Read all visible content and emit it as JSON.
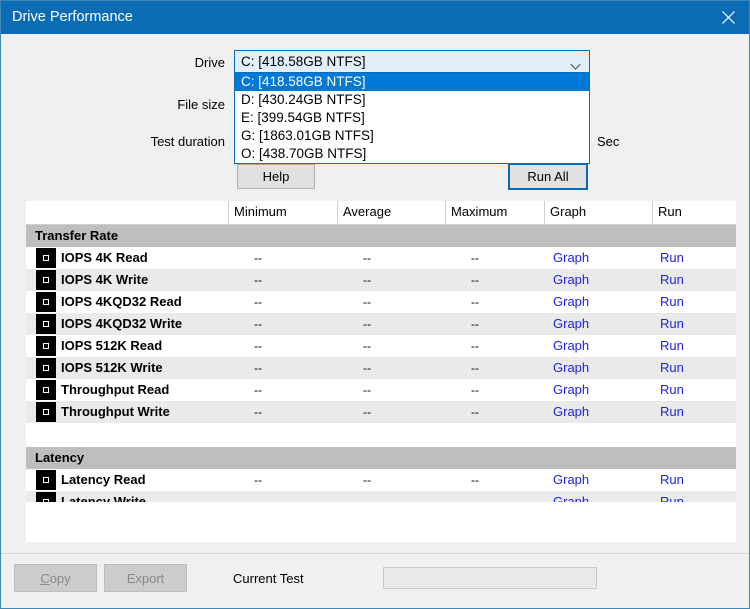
{
  "window": {
    "title": "Drive Performance",
    "close_icon": "close-icon",
    "titlebar_color": "#0a6cb4"
  },
  "form": {
    "drive_label": "Drive",
    "file_size_label": "File size",
    "test_duration_label": "Test duration",
    "sec_label": "Sec",
    "drive_selected": "C: [418.58GB NTFS]",
    "drive_arrow_icon": "chevron-down-icon",
    "drive_options": [
      "C: [418.58GB NTFS]",
      "D: [430.24GB NTFS]",
      "E: [399.54GB NTFS]",
      "G: [1863.01GB NTFS]",
      "O: [438.70GB NTFS]"
    ],
    "help_label": "Help",
    "run_all_label": "Run All"
  },
  "grid": {
    "columns": [
      "Minimum",
      "Average",
      "Maximum",
      "Graph",
      "Run"
    ],
    "sections": [
      {
        "title": "Transfer Rate",
        "rows": [
          {
            "name": "IOPS 4K Read",
            "min": "--",
            "avg": "--",
            "max": "--",
            "graph": "Graph",
            "run": "Run"
          },
          {
            "name": "IOPS 4K Write",
            "min": "--",
            "avg": "--",
            "max": "--",
            "graph": "Graph",
            "run": "Run"
          },
          {
            "name": "IOPS 4KQD32 Read",
            "min": "--",
            "avg": "--",
            "max": "--",
            "graph": "Graph",
            "run": "Run"
          },
          {
            "name": "IOPS 4KQD32 Write",
            "min": "--",
            "avg": "--",
            "max": "--",
            "graph": "Graph",
            "run": "Run"
          },
          {
            "name": "IOPS 512K Read",
            "min": "--",
            "avg": "--",
            "max": "--",
            "graph": "Graph",
            "run": "Run"
          },
          {
            "name": "IOPS 512K Write",
            "min": "--",
            "avg": "--",
            "max": "--",
            "graph": "Graph",
            "run": "Run"
          },
          {
            "name": "Throughput Read",
            "min": "--",
            "avg": "--",
            "max": "--",
            "graph": "Graph",
            "run": "Run"
          },
          {
            "name": "Throughput Write",
            "min": "--",
            "avg": "--",
            "max": "--",
            "graph": "Graph",
            "run": "Run"
          }
        ]
      },
      {
        "title": "Latency",
        "rows": [
          {
            "name": "Latency Read",
            "min": "--",
            "avg": "--",
            "max": "--",
            "graph": "Graph",
            "run": "Run"
          },
          {
            "name": "Latency Write",
            "min": "--",
            "avg": "--",
            "max": "--",
            "graph": "Graph",
            "run": "Run"
          }
        ]
      }
    ],
    "row_icon": "checkbox-square-icon",
    "link_color": "#1f1fe0",
    "section_header_color": "#bebebe",
    "alt_row_color": "#eaeaea"
  },
  "footer": {
    "copy_label": "Copy",
    "copy_accel": "C",
    "copy_rest": "opy",
    "export_label": "Export",
    "current_test_label": "Current Test",
    "current_test_value": ""
  }
}
